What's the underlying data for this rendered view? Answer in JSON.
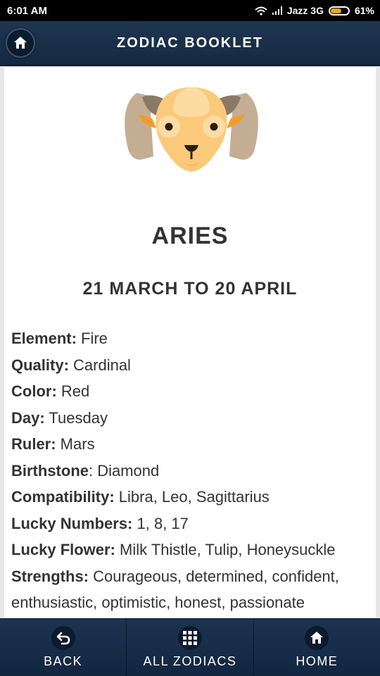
{
  "status_bar": {
    "time": "6:01 AM",
    "carrier": "Jazz 3G",
    "battery": "61%",
    "battery_level": 0.61
  },
  "app_bar": {
    "title": "ZODIAC BOOKLET",
    "home_icon": "home-icon"
  },
  "sign": {
    "name": "ARIES",
    "date_range": "21 MARCH TO 20 APRIL",
    "details": [
      {
        "label": "Element:",
        "value": " Fire"
      },
      {
        "label": "Quality:",
        "value": " Cardinal"
      },
      {
        "label": "Color:",
        "value": " Red"
      },
      {
        "label": "Day:",
        "value": " Tuesday"
      },
      {
        "label": "Ruler:",
        "value": " Mars"
      },
      {
        "label": "Birthstone",
        "value": ": Diamond"
      },
      {
        "label": "Compatibility:",
        "value": " Libra, Leo, Sagittarius"
      },
      {
        "label": "Lucky Numbers:",
        "value": " 1, 8, 17"
      },
      {
        "label": "Lucky Flower:",
        "value": " Milk Thistle, Tulip, Honeysuckle"
      },
      {
        "label": "Strengths:",
        "value": " Courageous, determined, confident, enthusiastic, optimistic, honest, passionate"
      }
    ]
  },
  "bottom_nav": {
    "back_label": "BACK",
    "all_zodiacs_label": "ALL ZODIACS",
    "home_label": "HOME"
  },
  "colors": {
    "header_bg": "#1b3049",
    "ram_face": "#fbc97a",
    "ram_horn": "#c8b49a"
  }
}
